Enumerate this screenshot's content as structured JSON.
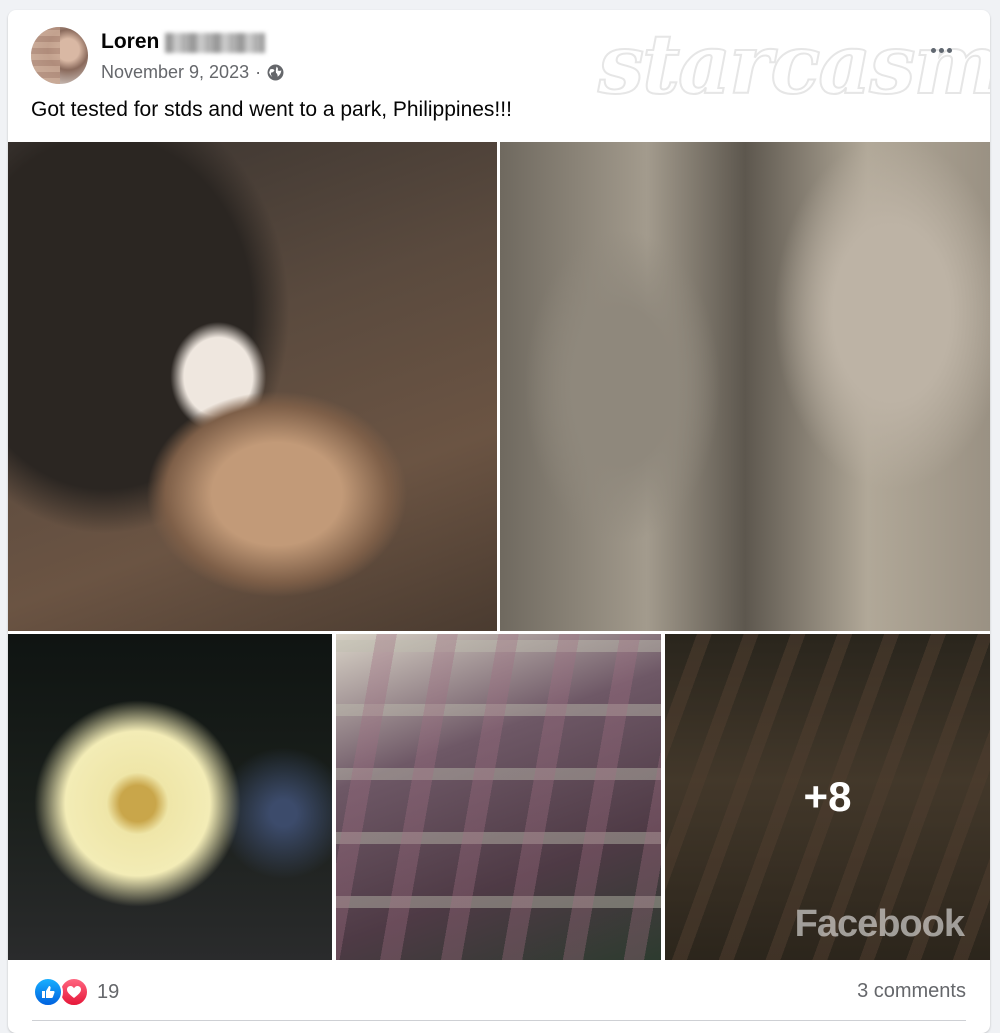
{
  "post": {
    "author_name": "Loren",
    "date": "November 9, 2023",
    "separator": "·",
    "text": "Got tested for stds and went to a park, Philippines!!!",
    "watermark": "starcasm"
  },
  "photos": {
    "more_count": "+8",
    "facebook_watermark": "Facebook"
  },
  "footer": {
    "reaction_count": "19",
    "comments_label": "3 comments"
  },
  "icons": {
    "globe": "globe-icon",
    "like": "like-icon",
    "love": "love-icon",
    "more": "more-options-icon"
  },
  "colors": {
    "like_blue": "#1877f2",
    "love_red": "#f33e58",
    "secondary_text": "#65676b"
  }
}
